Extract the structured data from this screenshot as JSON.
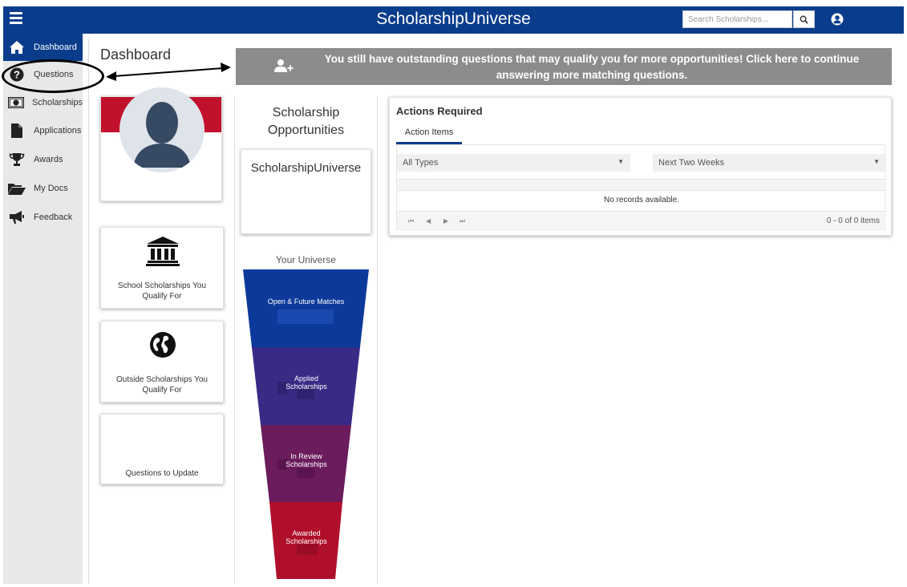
{
  "app": {
    "title": "ScholarshipUniverse"
  },
  "search": {
    "placeholder": "Search Scholarships..."
  },
  "colors": {
    "brand_blue": "#0a3c8c",
    "brand_red": "#c0102c",
    "banner_gray": "#8c8c8c",
    "sidebar_bg": "#e8e8e8"
  },
  "sidebar": {
    "items": [
      {
        "label": "Dashboard",
        "icon": "home-icon",
        "active": true
      },
      {
        "label": "Questions",
        "icon": "question-circle-icon"
      },
      {
        "label": "Scholarships",
        "icon": "money-icon"
      },
      {
        "label": "Applications",
        "icon": "file-icon"
      },
      {
        "label": "Awards",
        "icon": "trophy-icon"
      },
      {
        "label": "My Docs",
        "icon": "folder-open-icon"
      },
      {
        "label": "Feedback",
        "icon": "megaphone-icon"
      }
    ]
  },
  "main": {
    "title": "Dashboard",
    "banner": {
      "text": "You still have outstanding questions that may qualify you for more opportunities! Click here to continue answering more matching questions."
    },
    "tiles": {
      "school": "School Scholarships You Qualify For",
      "outside": "Outside Scholarships You Qualify For",
      "questions": "Questions to Update"
    },
    "scholarships": {
      "title": "Scholarship Opportunities",
      "card_label": "ScholarshipUniverse",
      "universe_label": "Your Universe",
      "funnel": [
        {
          "label": "Open & Future Matches",
          "color": "#0d3a9a"
        },
        {
          "label": "Applied Scholarships",
          "color": "#3a2a86"
        },
        {
          "label": "In Review Scholarships",
          "color": "#6a1c5c"
        },
        {
          "label": "Awarded Scholarships",
          "color": "#b00f2c"
        }
      ]
    },
    "actions": {
      "title": "Actions Required",
      "tab": "Action Items",
      "filter_type": "All Types",
      "filter_range": "Next Two Weeks",
      "empty": "No records available.",
      "pager_info": "0 - 0 of 0 items"
    }
  }
}
